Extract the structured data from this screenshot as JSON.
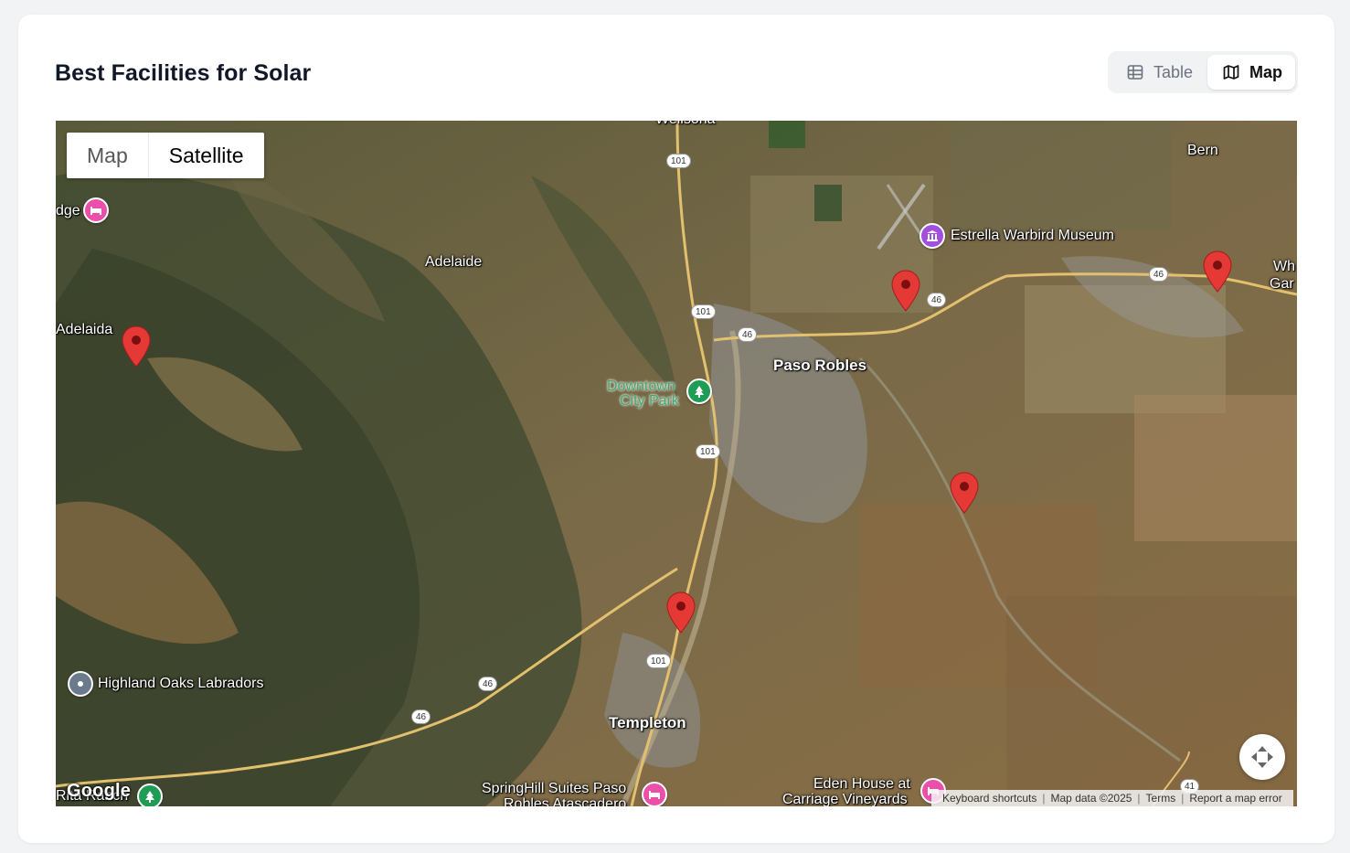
{
  "card": {
    "title": "Best Facilities for Solar"
  },
  "view_toggle": {
    "options": [
      {
        "label": "Table",
        "icon": "table-icon",
        "active": false
      },
      {
        "label": "Map",
        "icon": "map-icon",
        "active": true
      }
    ]
  },
  "map": {
    "type_control": {
      "map_label": "Map",
      "satellite_label": "Satellite",
      "selected": "Satellite"
    },
    "labels": {
      "wellsona": "Wellsona",
      "bern": "Bern",
      "adelaide": "Adelaide",
      "adelaida": "Adelaida",
      "edge_lodge": "dge",
      "estrella": "Estrella Warbird Museum",
      "paso_robles": "Paso Robles",
      "downtown_line1": "Downtown",
      "downtown_line2": "City Park",
      "whitley_line1": "Wh",
      "whitley_line2": "Gar",
      "highland": "Highland Oaks Labradors",
      "templeton": "Templeton",
      "springhill_line1": "SpringHill Suites Paso",
      "springhill_line2": "Robles Atascadero",
      "eden_line1": "Eden House at",
      "eden_line2": "Carriage Vineyards",
      "rita": "Rita Ranch"
    },
    "highway_shields": [
      "101",
      "101",
      "101",
      "101",
      "46",
      "46",
      "46",
      "46",
      "46",
      "41"
    ],
    "google_logo": "Google",
    "attribution": {
      "shortcuts": "Keyboard shortcuts",
      "data": "Map data ©2025",
      "terms": "Terms",
      "report": "Report a map error"
    },
    "marker_color": "#e53935"
  }
}
